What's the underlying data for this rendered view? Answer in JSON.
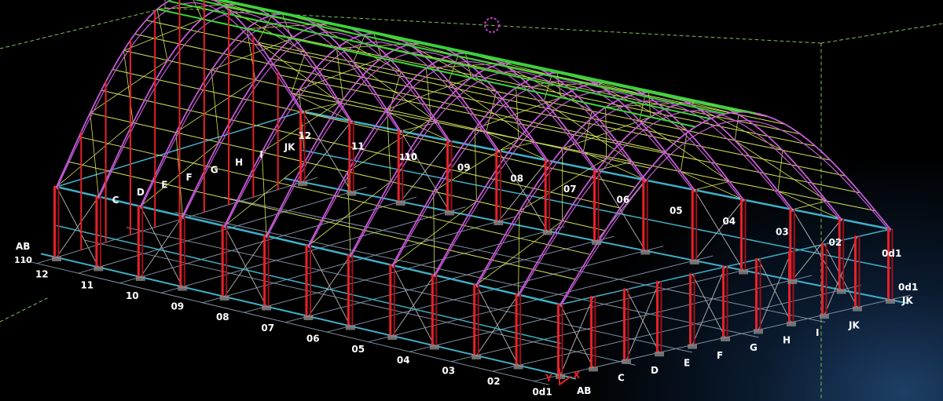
{
  "viewport": {
    "background": "#000000",
    "accent_glow": "#1d3f66"
  },
  "colors": {
    "column": "#e8202a",
    "column_dark": "#a0101a",
    "bracing": "#a8a8a8",
    "arch": "#c55ad6",
    "purlin": "#d7e35a",
    "roof_ridge": "#3ad43a",
    "base_beam": "#3fb0c8",
    "base_grid": "#7d8fa0",
    "bbox": "#7fbf5a",
    "ucs_marker": "#c23bc2",
    "labels": "#ffffff"
  },
  "icons": {
    "ucs_marker": "circle-target-icon",
    "axis_indicator": "xy-axis-icon"
  },
  "axis_indicator": {
    "x_label": "X",
    "y_label": "Y"
  },
  "grid_labels": {
    "front_numbers": [
      "12",
      "11",
      "10",
      "09",
      "08",
      "07",
      "06",
      "05",
      "04",
      "03",
      "02",
      "0d1"
    ],
    "front_letters": [
      "C",
      "D",
      "E",
      "F",
      "G",
      "H",
      "I",
      "JK"
    ],
    "corner_left": [
      "AB",
      "110"
    ],
    "back_numbers": [
      "12",
      "11",
      "10",
      "09",
      "08",
      "07",
      "06",
      "05",
      "04",
      "03",
      "02",
      "0d1"
    ],
    "back_letters": [
      "JK",
      "I",
      "H",
      "G",
      "F",
      "E",
      "D",
      "C"
    ],
    "corner_right_top": "110",
    "corner_right_bottom": "AB",
    "back_right_top": "0d1",
    "back_right_side": "JK"
  }
}
